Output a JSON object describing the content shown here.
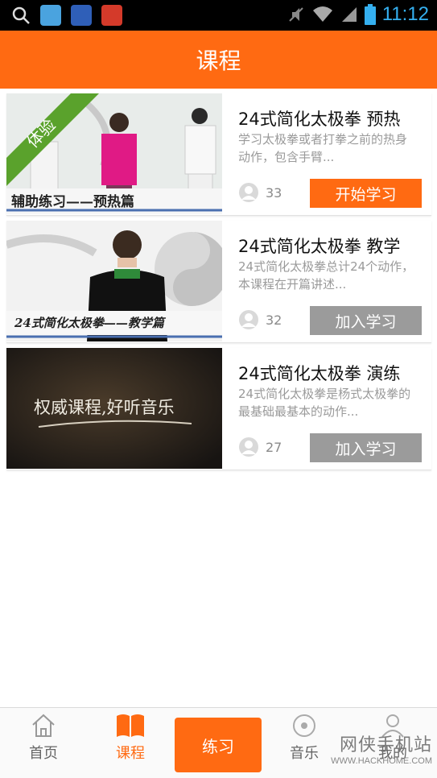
{
  "status_bar": {
    "time": "11:12"
  },
  "header": {
    "title": "课程"
  },
  "courses": [
    {
      "badge": "体验",
      "thumb_caption": "辅助练习——预热篇",
      "title": "24式简化太极拳 预热",
      "desc": "学习太极拳或者打拳之前的热身动作，包含手臂...",
      "count": "33",
      "button": "开始学习",
      "button_style": "orange"
    },
    {
      "thumb_caption": "24式简化太极拳——教学篇",
      "title": "24式简化太极拳 教学",
      "desc": "24式简化太极拳总计24个动作，本课程在开篇讲述...",
      "count": "32",
      "button": "加入学习",
      "button_style": "gray"
    },
    {
      "thumb_caption": "权威课程,好听音乐",
      "title": "24式简化太极拳 演练",
      "desc": "24式简化太极拳是杨式太极拳的最基础最基本的动作...",
      "count": "27",
      "button": "加入学习",
      "button_style": "gray"
    }
  ],
  "tabbar": {
    "home": "首页",
    "courses": "课程",
    "practice": "练习",
    "music": "音乐",
    "mine": "我的"
  },
  "watermark": {
    "main": "网侠手机站",
    "sub": "WWW.HACKHOME.COM"
  },
  "colors": {
    "accent": "#ff6a12",
    "gray_button": "#9b9b9b"
  }
}
